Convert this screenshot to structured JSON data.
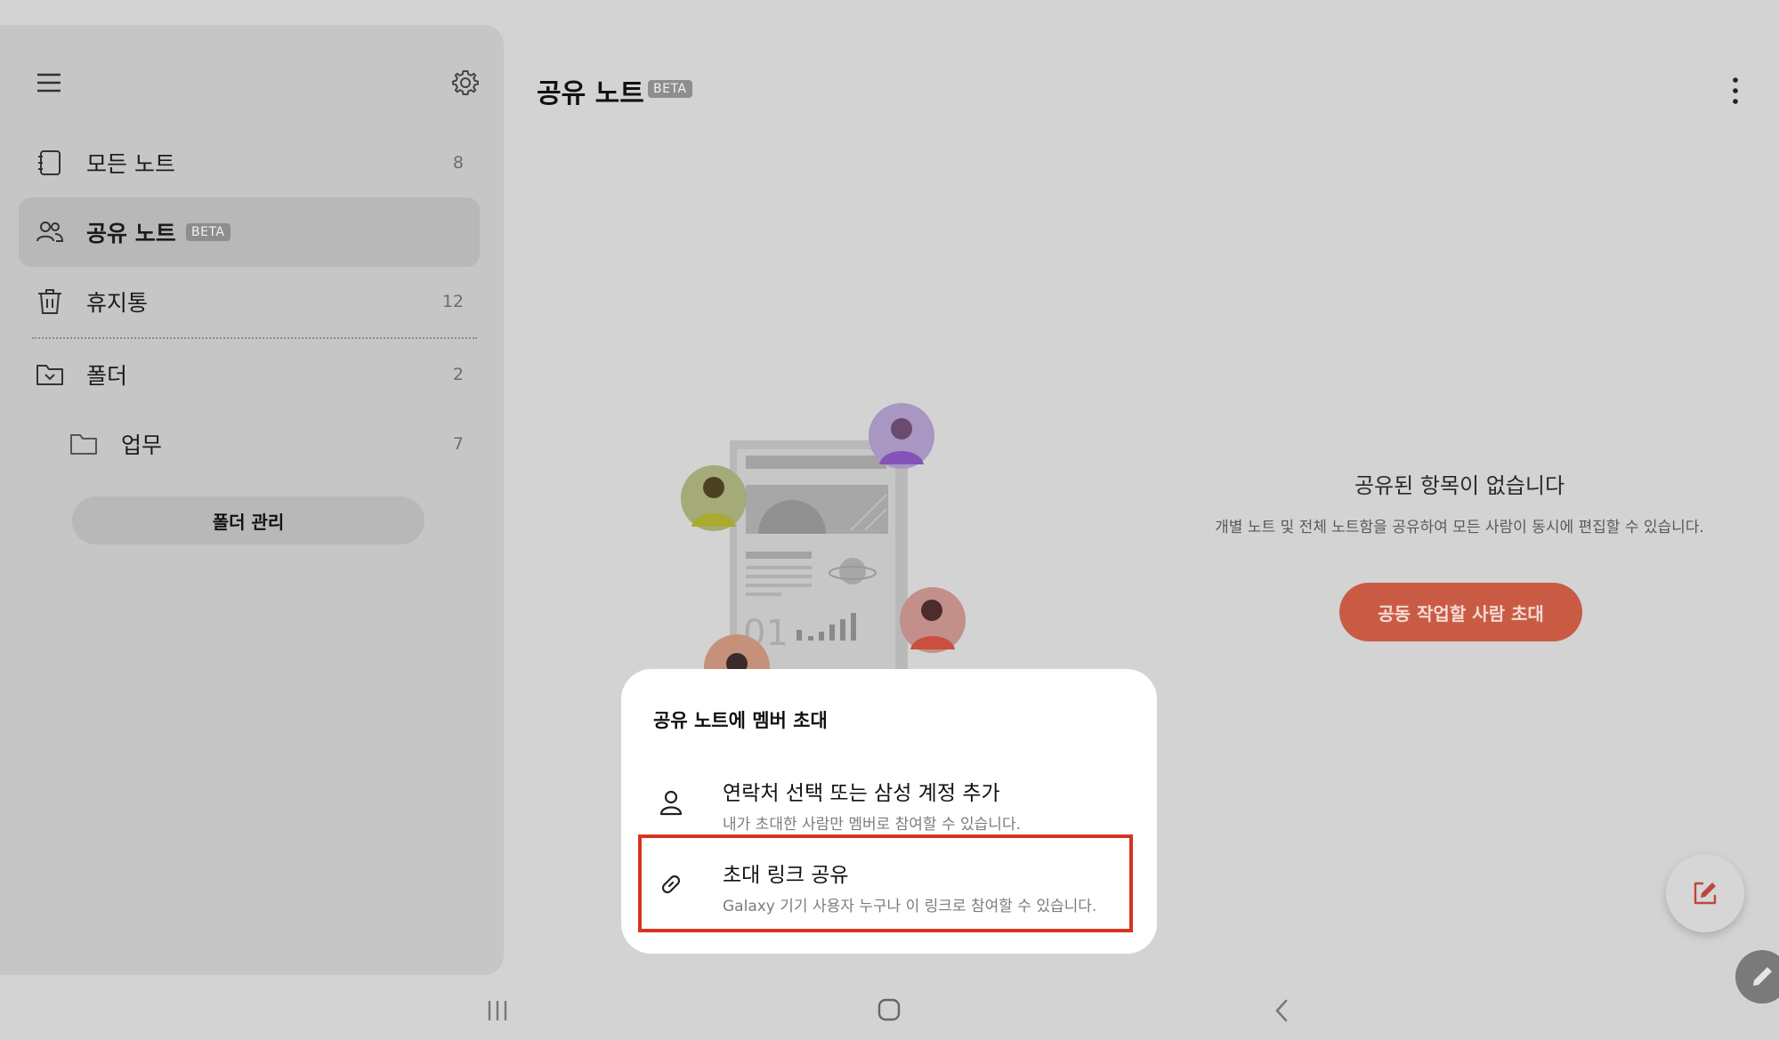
{
  "sidebar": {
    "items": [
      {
        "label": "모든 노트",
        "count": "8"
      },
      {
        "label": "공유 노트",
        "badge": "BETA"
      },
      {
        "label": "휴지통",
        "count": "12"
      },
      {
        "label": "폴더",
        "count": "2"
      },
      {
        "label": "업무",
        "count": "7"
      }
    ],
    "manage_button": "폴더 관리"
  },
  "header": {
    "title": "공유 노트",
    "badge": "BETA"
  },
  "empty_state": {
    "title": "공유된 항목이 없습니다",
    "description": "개별 노트 및 전체 노트함을 공유하여 모든 사람이 동시에 편집할 수 있습니다.",
    "button": "공동 작업할 사람 초대"
  },
  "illustration": {
    "number": "01"
  },
  "popup": {
    "title": "공유 노트에 멤버 초대",
    "options": [
      {
        "main": "연락처 선택 또는 삼성 계정 추가",
        "sub": "내가 초대한 사람만 멤버로 참여할 수 있습니다."
      },
      {
        "main": "초대 링크 공유",
        "sub": "Galaxy 기기 사용자 누구나 이 링크로 참여할 수 있습니다."
      }
    ]
  },
  "colors": {
    "accent": "#c95b45",
    "highlight": "#d6341f"
  }
}
